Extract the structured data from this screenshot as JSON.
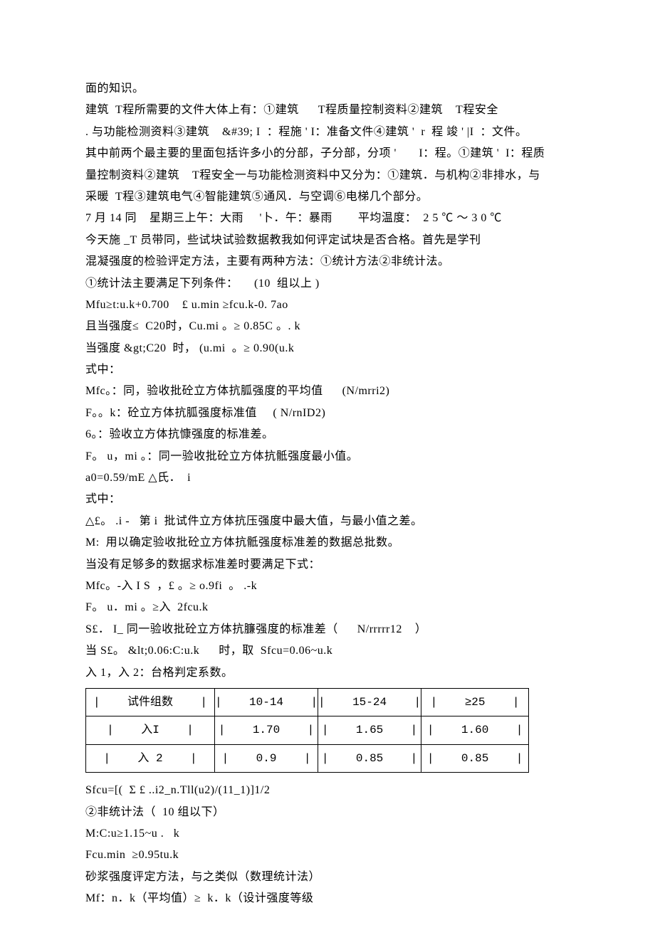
{
  "lines": {
    "l00": "面的知识。",
    "l01": "建筑  T程所需要的文件大体上有：①建筑      T程质量控制资料②建筑    T程安全",
    "l02": ". 与功能检测资料③建筑    &#39; I  ：程施 ' I：准备文件④建筑 '  r  程 竣 ' |I  ：文件。",
    "l03": "其中前两个最主要的里面包括许多小的分部，子分部，分项 '       I：程。①建筑 '  I：程质",
    "l04": "量控制资料②建筑    T程安全一与功能检测资料中又分为：①建筑．与机构②非排水，与",
    "l05": "采暖  T程③建筑电气④智能建筑⑤通风．与空调⑥电梯几个部分。",
    "l06": "7 月 14 同    星期三上午：大雨     '卜．午：暴雨        平均温度：  2 5 ℃ ～ 3 0 ℃",
    "l07": "今天施 _T 员带同，些试块试验数据教我如何评定试块是否合格。首先是学刊",
    "l08": "混凝强度的检验评定方法，主要有两种方法：①统计方法②非统计法。",
    "l09": "①统计法主要满足下列条件：     (10  组以上 )",
    "l10": "Mfu≥t:u.k+0.700    £ u.min ≥fcu.k-0. 7ao",
    "l11": "且当强度≤  C20时，Cu.mi 。≥ 0.85C 。. k",
    "l12": "当强度 &gt;C20  时， (u.mi  。≥ 0.90(u.k",
    "l13": "式中：",
    "l14": "Mfc。：同，验收批砼立方体抗胍强度的平均值      (N/mrri2)",
    "l15": "F。。k：砼立方体抗胍强度标准值     ( N/rnID2)",
    "l16": "6。：验收立方体抗慷强度的标准差。",
    "l17": "F。 u，mi 。：同一验收批砼立方体抗骶强度最小值。",
    "l18": "a0=0.59/mE △氏．  i",
    "l19": "式中：",
    "l20": "△£。 .i -   第 i  批试件立方体抗压强度中最大值，与最小值之差。",
    "l21": "M:  用以确定验收批砼立方体抗骶强度标准差的数据总批数。",
    "l22": "当没有足够多的数据求标准差时要满足下式：",
    "l23": "Mfc。-入 I S  ，£ 。≥ o.9fi  。 .-k",
    "l24": "F。 u．mi 。≥入  2fcu.k",
    "l25": "S£． I_ 同一验收批砼立方体抗臁强度的标准差（      N/rrrrr12    ）",
    "l26": "当 S£。 &lt;0.06:C:u.k      时，取  Sfcu=0.06~u.k",
    "l27": "入 1，入 2：台格判定系数。",
    "l28": "Sfcu=[(  Σ £ ..i2_n.Tll(u2)/(11_1)]1/2",
    "l29": "②非统计法（  10 组以下）",
    "l30": "M:C:u≥1.15~u .   k",
    "l31": "Fcu.min  ≥0.95tu.k",
    "l32": "砂浆强度评定方法，与之类似（数理统计法）",
    "l33": "Mf：n．k（平均值）≥  k．k（设计强度等级"
  },
  "table": {
    "header": [
      "试件组数",
      "10-14",
      "15-24",
      "≥25"
    ],
    "rows": [
      {
        "label": "入I",
        "cells": [
          "1.70",
          "1.65",
          "1.60"
        ]
      },
      {
        "label": "入 2",
        "cells": [
          "0.9",
          "0.85",
          "0.85"
        ]
      }
    ]
  }
}
